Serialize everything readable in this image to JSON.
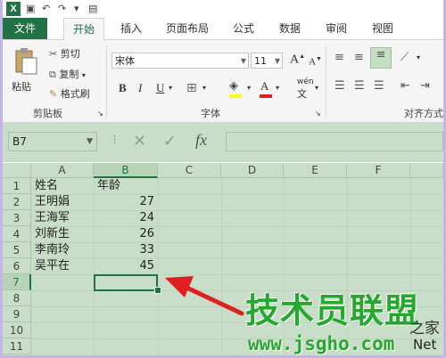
{
  "ribbon_tabs": [
    "文件",
    "开始",
    "插入",
    "页面布局",
    "公式",
    "数据",
    "审阅",
    "视图"
  ],
  "active_tab": "开始",
  "clipboard": {
    "paste": "粘贴",
    "cut": "剪切",
    "copy": "复制",
    "format_painter": "格式刷",
    "group_label": "剪贴板"
  },
  "font": {
    "name": "宋体",
    "size": "11",
    "group_label": "字体",
    "bold": "B",
    "italic": "I",
    "underline": "U",
    "phonetic": "wén",
    "grow": "A",
    "shrink": "A"
  },
  "alignment": {
    "group_label": "对齐方式"
  },
  "formula_bar": {
    "name_box": "B7",
    "fx": "fx",
    "value": ""
  },
  "columns": [
    "A",
    "B",
    "C",
    "D",
    "E",
    "F"
  ],
  "selected_column": "B",
  "rows": [
    "1",
    "2",
    "3",
    "4",
    "5",
    "6",
    "7",
    "8",
    "9",
    "10",
    "11"
  ],
  "selected_row": "7",
  "cells": {
    "a1": "姓名",
    "b1": "年龄",
    "a2": "王明娟",
    "b2": "27",
    "a3": "王海军",
    "b3": "24",
    "a4": "刘新生",
    "b4": "26",
    "a5": "李南玲",
    "b5": "33",
    "a6": "吴平在",
    "b6": "45"
  },
  "watermark": {
    "title": "技术员联盟",
    "suffix": "之家",
    "url": "www.jsgho.com",
    "net": "Net"
  },
  "colors": {
    "excel_green": "#217346",
    "sheet_bg": "#c9dec9",
    "watermark_green": "#26a82e",
    "arrow_red": "#e02020"
  }
}
